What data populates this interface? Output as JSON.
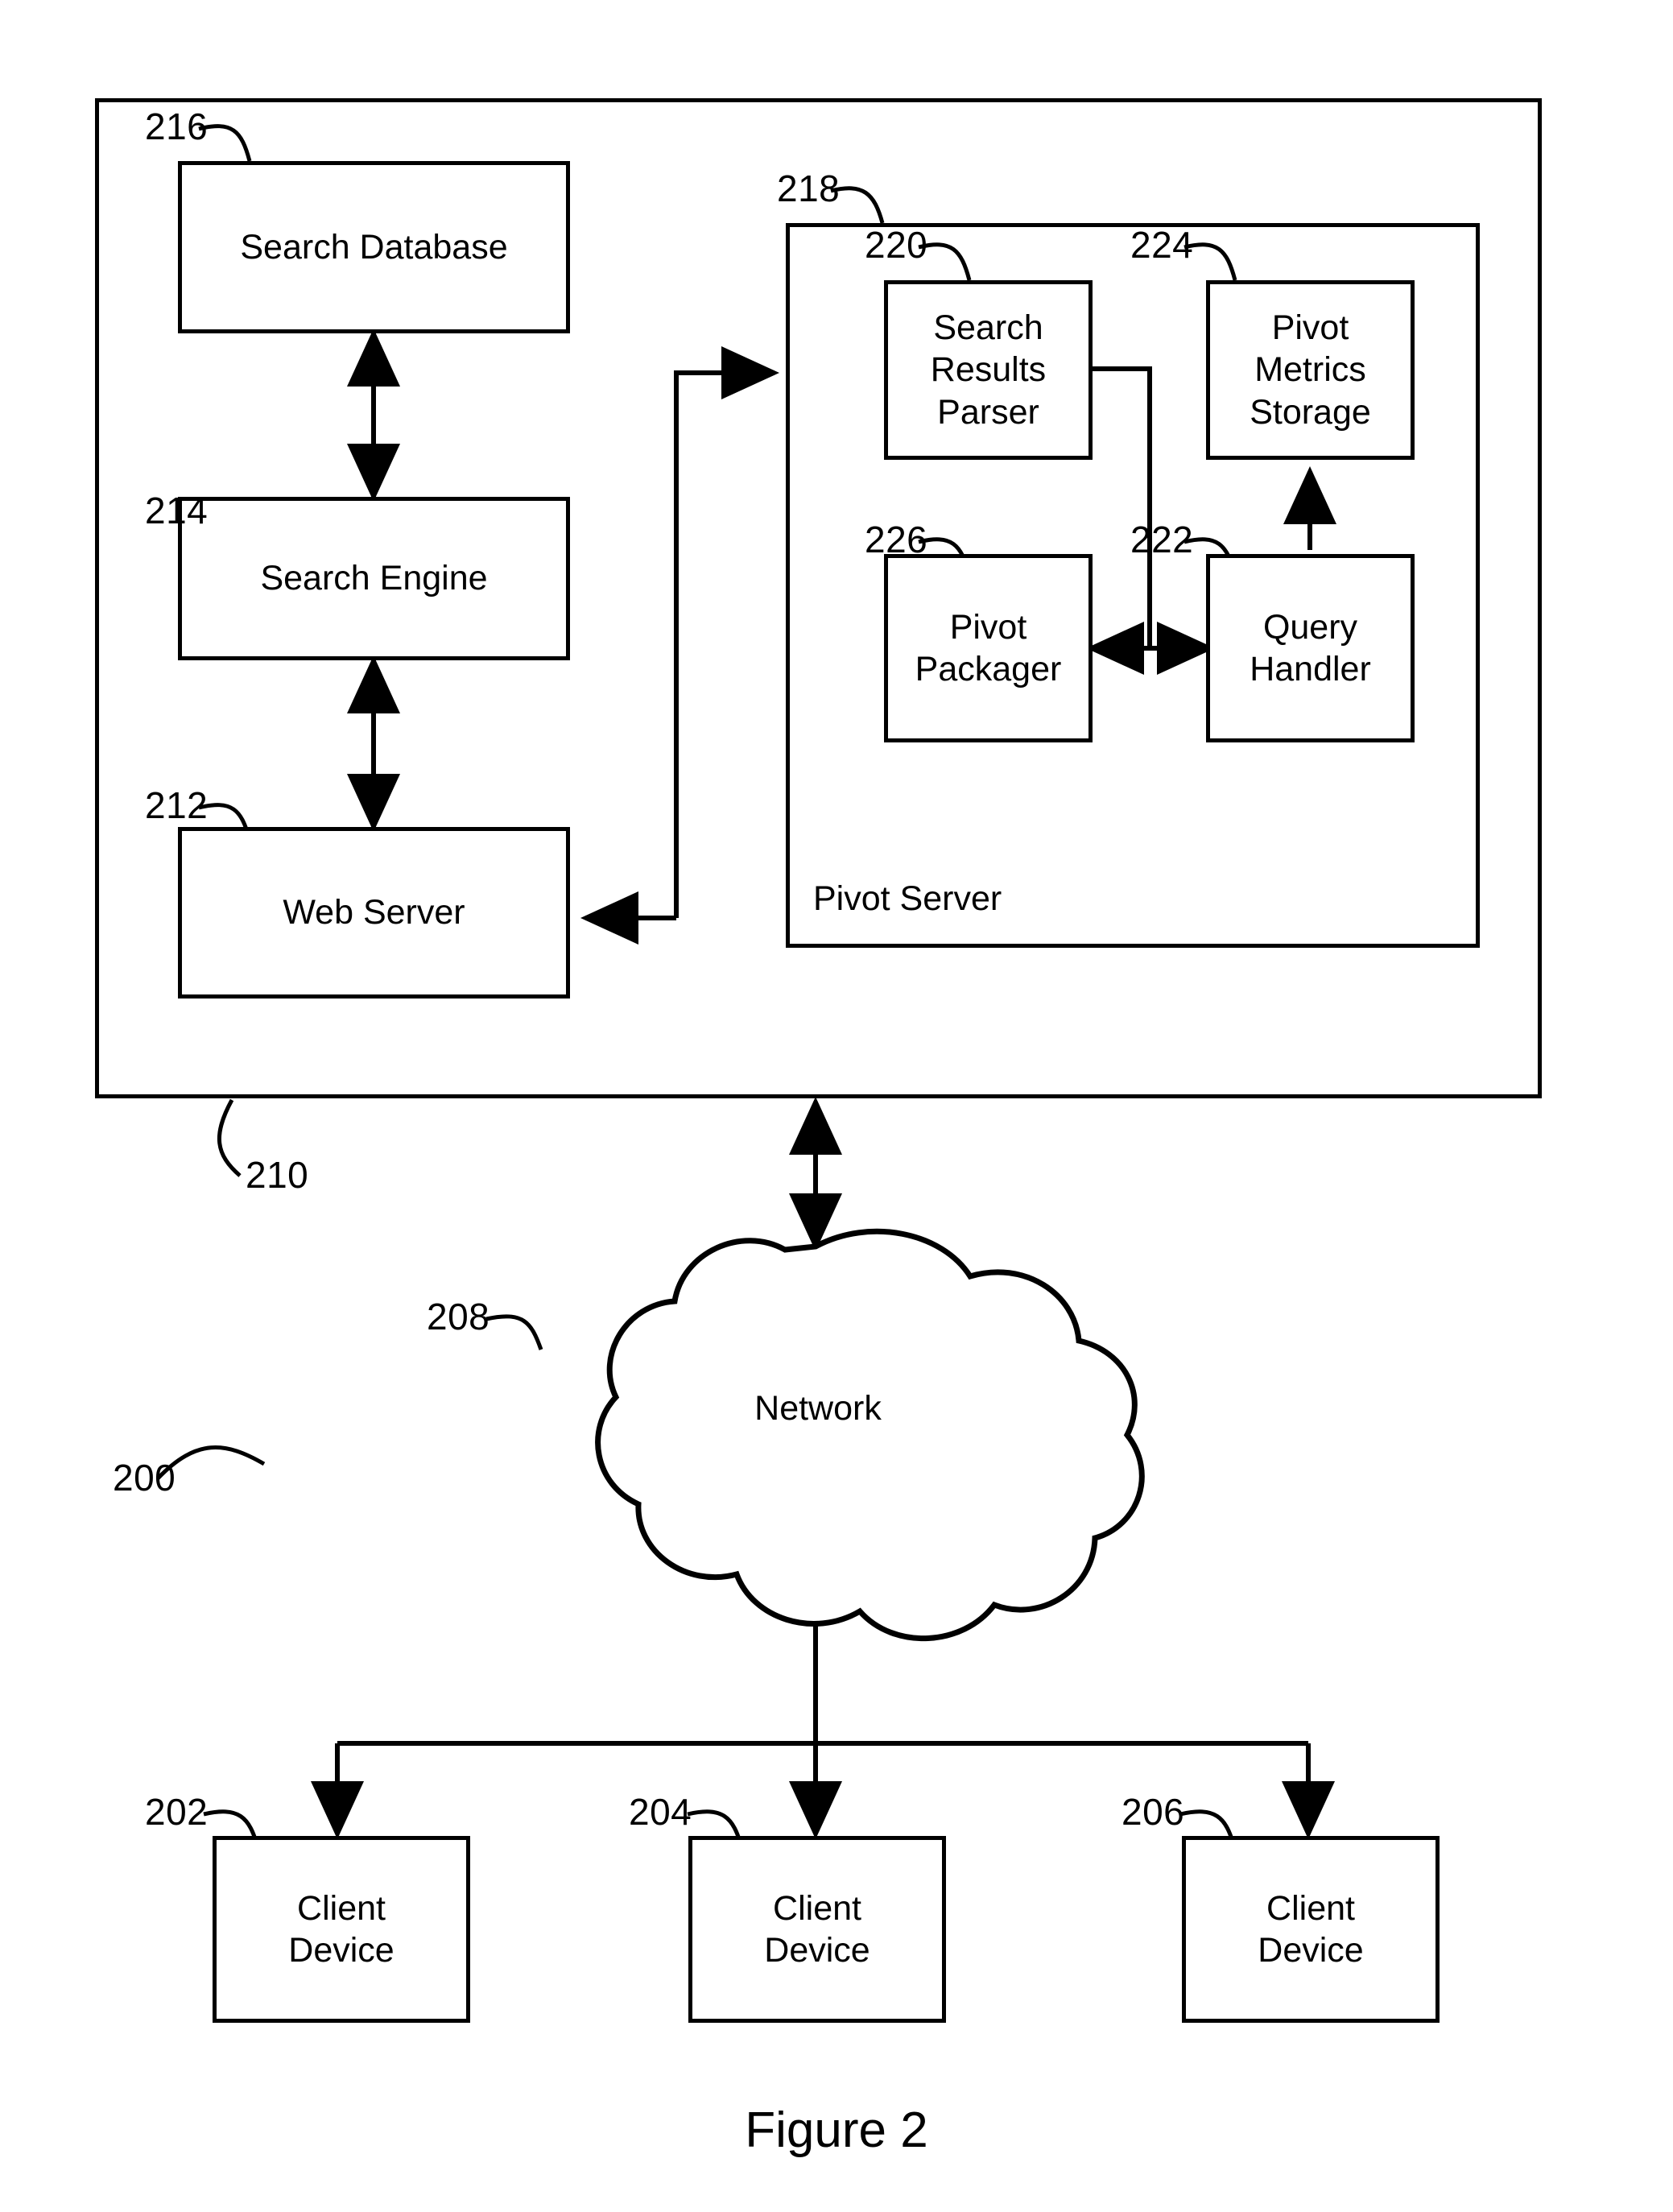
{
  "figure": {
    "caption": "Figure 2",
    "system_ref": "200"
  },
  "outer_system": {
    "ref": "210"
  },
  "nodes": {
    "search_database": {
      "label": "Search Database",
      "ref": "216"
    },
    "search_engine": {
      "label": "Search Engine",
      "ref": "214"
    },
    "web_server": {
      "label": "Web Server",
      "ref": "212"
    },
    "pivot_server": {
      "label": "Pivot Server",
      "ref": "218"
    },
    "search_results_parser": {
      "label": "Search\nResults\nParser",
      "ref": "220"
    },
    "pivot_metrics_storage": {
      "label": "Pivot\nMetrics\nStorage",
      "ref": "224"
    },
    "pivot_packager": {
      "label": "Pivot\nPackager",
      "ref": "226"
    },
    "query_handler": {
      "label": "Query\nHandler",
      "ref": "222"
    },
    "network": {
      "label": "Network",
      "ref": "208"
    },
    "client_device_1": {
      "label": "Client\nDevice",
      "ref": "202"
    },
    "client_device_2": {
      "label": "Client\nDevice",
      "ref": "204"
    },
    "client_device_3": {
      "label": "Client\nDevice",
      "ref": "206"
    }
  },
  "colors": {
    "stroke": "#000000",
    "background": "#ffffff"
  }
}
